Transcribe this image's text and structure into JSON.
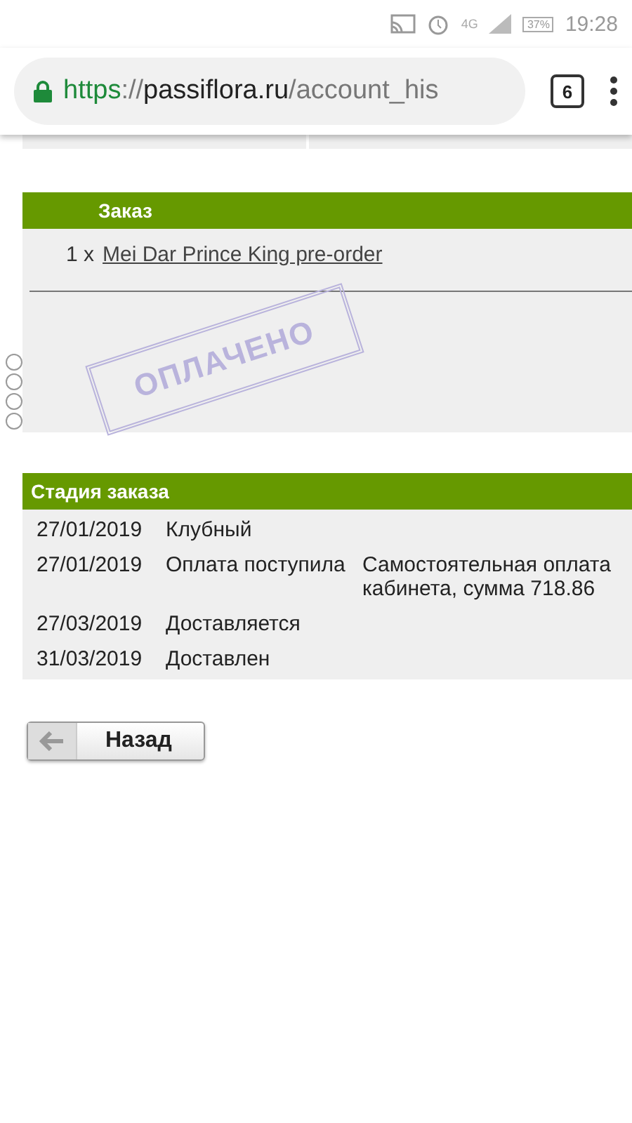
{
  "status_bar": {
    "network": "4G",
    "battery": "37%",
    "time": "19:28"
  },
  "browser": {
    "url_scheme": "https",
    "url_sep": "://",
    "url_host": "passiflora.ru",
    "url_path": "/account_his",
    "tabs_count": "6"
  },
  "order": {
    "title": "Заказ",
    "items": [
      {
        "qty": "1 x",
        "name": "Mei Dar Prince King pre-order"
      }
    ],
    "stamp": "ОПЛАЧЕНО"
  },
  "stages": {
    "title": "Стадия заказа",
    "rows": [
      {
        "date": "27/01/2019",
        "status": "Клубный",
        "note": []
      },
      {
        "date": "27/01/2019",
        "status": "Оплата поступила",
        "note": [
          "Самостоятельная оплата",
          "кабинета, сумма 718.86"
        ]
      },
      {
        "date": "27/03/2019",
        "status": "Доставляется",
        "note": []
      },
      {
        "date": "31/03/2019",
        "status": "Доставлен",
        "note": []
      }
    ]
  },
  "back_button": {
    "label": "Назад"
  }
}
